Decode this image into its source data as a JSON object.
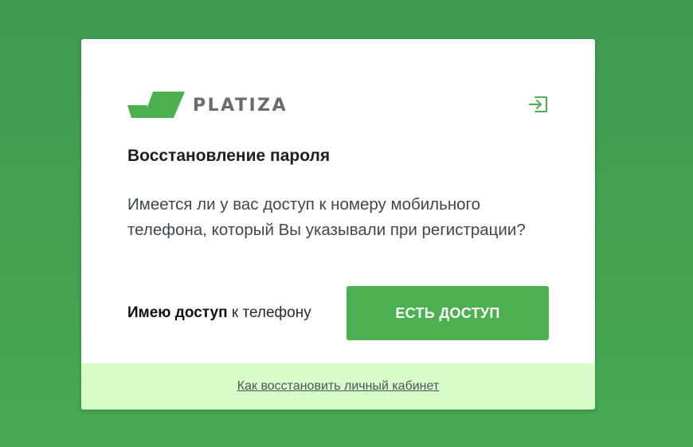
{
  "brand": {
    "name": "PLATIZA",
    "accent_color": "#4caf50",
    "background_color": "#43a151",
    "footer_color": "#d8fcc7"
  },
  "header": {
    "login_icon": "login-icon"
  },
  "card": {
    "title": "Восстановление пароля",
    "question": "Имеется ли у вас доступ к номеру мобильного телефона, который Вы указывали при регистрации?",
    "access_strong": "Имею доступ",
    "access_rest": " к телефону",
    "access_button": "ЕСТЬ ДОСТУП"
  },
  "footer": {
    "link": "Как восстановить личный кабинет"
  }
}
